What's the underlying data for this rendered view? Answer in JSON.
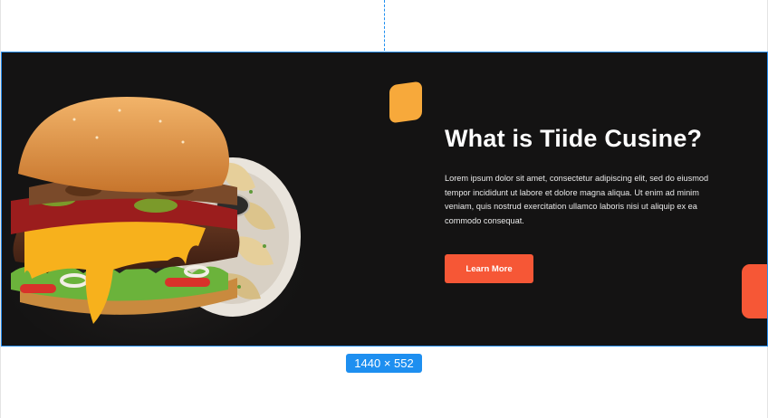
{
  "hero": {
    "title": "What is Tiide Cusine?",
    "description": "Lorem ipsum dolor sit amet, consectetur adipiscing elit, sed do eiusmod tempor incididunt ut labore et dolore magna aliqua. Ut enim ad minim veniam, quis nostrud exercitation ullamco laboris nisi ut aliquip ex ea commodo consequat.",
    "cta_label": "Learn More",
    "image_icon": "burger-image"
  },
  "canvas": {
    "frame_size_label": "1440 × 552"
  },
  "colors": {
    "background": "#141313",
    "accent_orange": "#f7a93b",
    "accent_red": "#f65736",
    "selection_blue": "#1e8ff0",
    "title_text": "#ffffff"
  }
}
